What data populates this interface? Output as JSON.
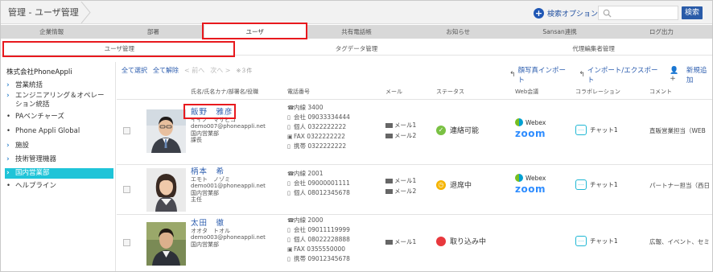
{
  "breadcrumb": "管理 - ユーザ管理",
  "header": {
    "search_option": "検索オプション",
    "search_placeholder": "",
    "search_button": "検索"
  },
  "tabs": [
    "企業情報",
    "部署",
    "ユーザ",
    "共有電話帳",
    "お知らせ",
    "Sansan連携",
    "ログ出力"
  ],
  "subtabs": [
    "ユーザ管理",
    "タグデータ管理",
    "代理編集者管理"
  ],
  "sidebar": {
    "org": "株式会社PhoneAppli",
    "items": [
      {
        "label": "営業統括",
        "type": "chevron"
      },
      {
        "label": "エンジニアリング＆オペレーション統括",
        "line1": "エンジニアリング＆オペレー",
        "line2": "ション統括",
        "type": "chevron"
      },
      {
        "label": "PAベンチャーズ",
        "type": "bullet"
      },
      {
        "label": "Phone Appli Global",
        "type": "bullet"
      },
      {
        "label": "施設",
        "type": "chevron"
      },
      {
        "label": "技術管理機器",
        "type": "chevron"
      },
      {
        "label": "国内営業部",
        "type": "chevron",
        "active": true
      },
      {
        "label": "ヘルプライン",
        "type": "bullet"
      }
    ]
  },
  "toolbar": {
    "select_all": "全て選択",
    "deselect_all": "全て解除",
    "prev": "前へ",
    "next": "次へ",
    "count": "※３件",
    "photo_import": "顔写真インポート",
    "import_export": "インポート/エクスポート",
    "add_new": "新規追加"
  },
  "table": {
    "headers": {
      "name": "氏名/氏名カナ/部署名/役職",
      "phone": "電話番号",
      "mail": "メール",
      "status": "ステータス",
      "web": "Web会議",
      "collab": "コラボレーション",
      "comment": "コメント"
    },
    "rows": [
      {
        "name": "飯野　雅彦",
        "kana": "イイノ　マサヒコ",
        "email": "demo007@phoneappli.net",
        "dept": "国内営業部",
        "title": "課長",
        "phones": [
          {
            "label": "内線",
            "value": "3400"
          },
          {
            "label": "会社",
            "value": "09033334444"
          },
          {
            "label": "個人",
            "value": "0322222222"
          },
          {
            "label": "FAX",
            "value": "0322222222"
          },
          {
            "label": "携帯",
            "value": "0322222222"
          }
        ],
        "mails": [
          "メール1",
          "メール2"
        ],
        "status": "連絡可能",
        "status_color": "#7ac143",
        "status_icon": "check-icon",
        "web": {
          "webex": "Webex",
          "zoom": "zoom"
        },
        "collab": "チャット1",
        "comment": "直販営業担当（WEB"
      },
      {
        "name": "柄本　希",
        "kana": "エモト　ノゾミ",
        "email": "demo001@phoneappli.net",
        "dept": "国内営業部",
        "title": "主任",
        "phones": [
          {
            "label": "内線",
            "value": "2001"
          },
          {
            "label": "会社",
            "value": "09000001111"
          },
          {
            "label": "個人",
            "value": "08012345678"
          }
        ],
        "mails": [
          "メール1",
          "メール2"
        ],
        "status": "退席中",
        "status_color": "#f5b400",
        "status_icon": "clock-icon",
        "web": {
          "webex": "Webex",
          "zoom": "zoom"
        },
        "collab": "チャット1",
        "comment": "パートナー担当（西日"
      },
      {
        "name": "太田　徹",
        "kana": "オオタ　トオル",
        "email": "demo003@phoneappli.net",
        "dept": "国内営業部",
        "title": "",
        "phones": [
          {
            "label": "内線",
            "value": "2000"
          },
          {
            "label": "会社",
            "value": "09011119999"
          },
          {
            "label": "個人",
            "value": "08022228888"
          },
          {
            "label": "FAX",
            "value": "0355550000"
          },
          {
            "label": "携帯",
            "value": "09012345678"
          }
        ],
        "mails": [
          "メール1"
        ],
        "status": "取り込み中",
        "status_color": "#e8383d",
        "status_icon": "busy-icon",
        "web": {},
        "collab": "チャット1",
        "comment": "広報、イベント、セミ"
      }
    ]
  },
  "colors": {
    "highlight": "#e8191e",
    "link": "#2b5cae",
    "active_sidebar": "#1fc4d8",
    "search_button": "#2a5ba8"
  }
}
